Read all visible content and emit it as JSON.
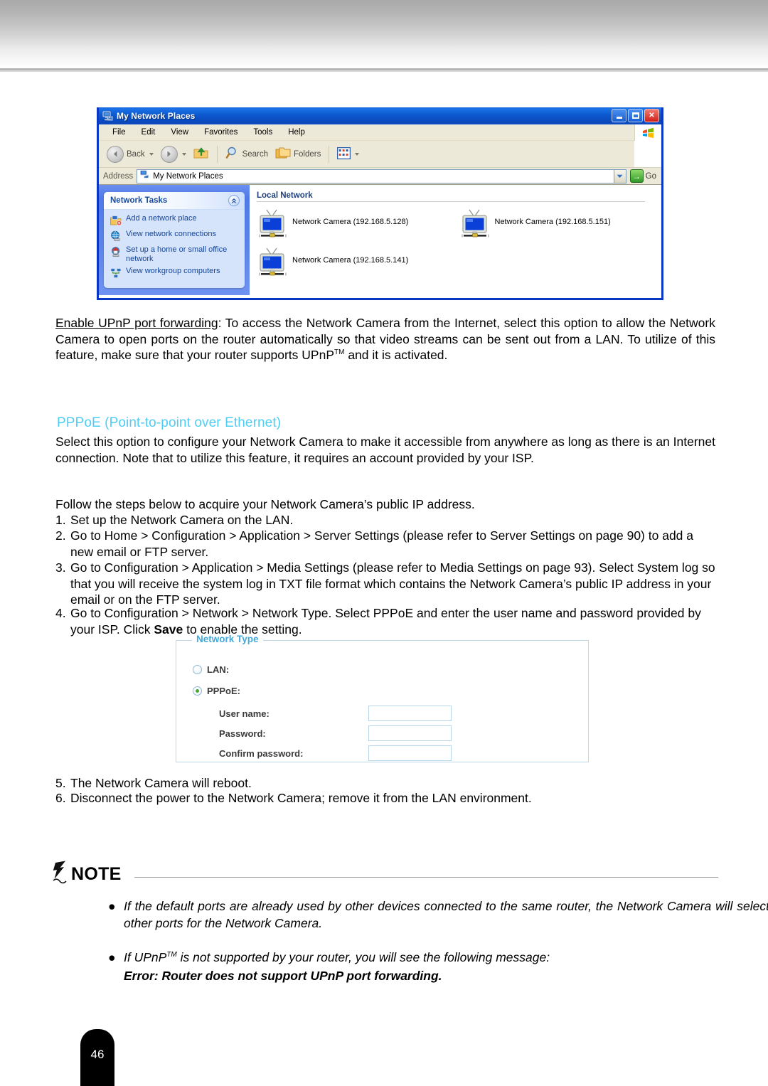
{
  "explorer": {
    "title": "My Network Places",
    "window_buttons": {
      "minimize": "_",
      "maximize": "□",
      "close": "✕"
    },
    "menu": [
      "File",
      "Edit",
      "View",
      "Favorites",
      "Tools",
      "Help"
    ],
    "toolbar": {
      "back": "Back",
      "forward": "",
      "up": "",
      "search": "Search",
      "folders": "Folders",
      "views": ""
    },
    "address": {
      "label": "Address",
      "value": "My Network Places",
      "go_label": "Go"
    },
    "sidebar": {
      "panel_title": "Network Tasks",
      "items": [
        {
          "label": "Add a network place",
          "icon": "add-network-place-icon"
        },
        {
          "label": "View network connections",
          "icon": "network-connections-icon"
        },
        {
          "label": "Set up a home or small office network",
          "icon": "home-network-wizard-icon"
        },
        {
          "label": "View workgroup computers",
          "icon": "workgroup-computers-icon"
        }
      ]
    },
    "main": {
      "group_header": "Local Network",
      "devices": [
        "Network Camera (192.168.5.128)",
        "Network Camera (192.168.5.151)",
        "Network Camera (192.168.5.141)"
      ]
    }
  },
  "upnp_para": {
    "lead": "Enable UPnP port forwarding",
    "rest_a": ": To access the Network Camera from the Internet, select this option to allow the Network Camera to open ports on the router automatically so that video streams can be sent out from a LAN. To utilize of this feature, make sure that your router supports UPnP",
    "sup": "TM",
    "rest_b": " and it is activated."
  },
  "pppoe": {
    "heading": "PPPoE (Point-to-point over Ethernet)",
    "intro": "Select this option to configure your Network Camera to make it accessible from anywhere as long as there is an Internet connection. Note that to utilize this feature, it requires an account provided by your ISP.",
    "follow_line": "Follow the steps below to acquire your Network Camera’s public IP address.",
    "steps": [
      {
        "num": "1.",
        "text": "Set up the Network Camera on the LAN."
      },
      {
        "num": "2.",
        "text": "Go to Home > Configuration > Application > Server Settings (please refer to Server Settings on page 90) to add a new email or FTP server."
      },
      {
        "num": "3.",
        "text": "Go to Configuration > Application > Media Settings (please refer to Media Settings on page 93). Select System log so that you will receive the system log in TXT file format which contains the Network Camera’s public IP address in your email or on the FTP server."
      },
      {
        "num": "4.",
        "text_a": "Go to Configuration > Network > Network Type. Select PPPoE and enter the user name and password provided by your ISP. Click ",
        "bold": "Save",
        "text_b": " to enable the setting."
      },
      {
        "num": "5.",
        "text": "The Network Camera will reboot."
      },
      {
        "num": "6.",
        "text": "Disconnect the power to the Network Camera; remove it from the LAN environment."
      }
    ]
  },
  "network_type_form": {
    "legend": "Network Type",
    "options": [
      {
        "label": "LAN:",
        "selected": false
      },
      {
        "label": "PPPoE:",
        "selected": true
      }
    ],
    "fields": [
      {
        "label": "User name:",
        "value": ""
      },
      {
        "label": "Password:",
        "value": ""
      },
      {
        "label": "Confirm password:",
        "value": ""
      }
    ]
  },
  "note": {
    "title": "NOTE",
    "items": [
      {
        "bullet": "●",
        "text": "If the default ports are already used by other devices connected to the same router, the Network Camera will select other ports for the Network Camera."
      },
      {
        "bullet": "●",
        "text_a": "If UPnP",
        "sup": "TM",
        "text_b": " is not supported by your router, you will see the following message:",
        "emphasis": "Error: Router does not support UPnP port forwarding."
      }
    ]
  },
  "footer": {
    "page_number": "46"
  },
  "colors": {
    "heading_cyan": "#4ecdf5",
    "titlebar_blue": "#0b5fd4",
    "sidebar_link": "#12459b",
    "form_border": "#bcd7e8"
  }
}
